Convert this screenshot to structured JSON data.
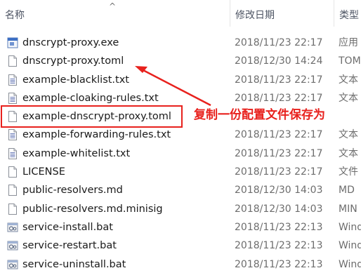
{
  "header": {
    "name_label": "名称",
    "date_label": "修改日期",
    "type_label": "类型",
    "sort_arrow": "^"
  },
  "files": [
    {
      "name": "dnscrypt-proxy.exe",
      "date": "2018/11/23 22:17",
      "type": "应用",
      "icon": "exe-icon"
    },
    {
      "name": "dnscrypt-proxy.toml",
      "date": "2018/12/30 14:24",
      "type": "TOM",
      "icon": "file-icon"
    },
    {
      "name": "example-blacklist.txt",
      "date": "2018/11/23 22:17",
      "type": "文本",
      "icon": "text-file-icon"
    },
    {
      "name": "example-cloaking-rules.txt",
      "date": "2018/11/23 22:17",
      "type": "文本",
      "icon": "text-file-icon"
    },
    {
      "name": "example-dnscrypt-proxy.toml",
      "date": "",
      "type": "",
      "icon": "file-icon"
    },
    {
      "name": "example-forwarding-rules.txt",
      "date": "2018/11/23 22:17",
      "type": "文本",
      "icon": "text-file-icon"
    },
    {
      "name": "example-whitelist.txt",
      "date": "2018/11/23 22:17",
      "type": "文本",
      "icon": "text-file-icon"
    },
    {
      "name": "LICENSE",
      "date": "2018/11/23 22:17",
      "type": "文件",
      "icon": "file-icon"
    },
    {
      "name": "public-resolvers.md",
      "date": "2018/12/30 14:03",
      "type": "MD",
      "icon": "file-icon"
    },
    {
      "name": "public-resolvers.md.minisig",
      "date": "2018/12/30 14:03",
      "type": "MIN",
      "icon": "file-icon"
    },
    {
      "name": "service-install.bat",
      "date": "2018/11/23 22:13",
      "type": "Wind",
      "icon": "bat-icon"
    },
    {
      "name": "service-restart.bat",
      "date": "2018/11/23 22:13",
      "type": "Wind",
      "icon": "bat-icon"
    },
    {
      "name": "service-uninstall.bat",
      "date": "2018/11/23 22:13",
      "type": "Wind",
      "icon": "bat-icon"
    }
  ],
  "annotation": {
    "text": "复制一份配置文件保存为",
    "color": "#e8211d"
  }
}
